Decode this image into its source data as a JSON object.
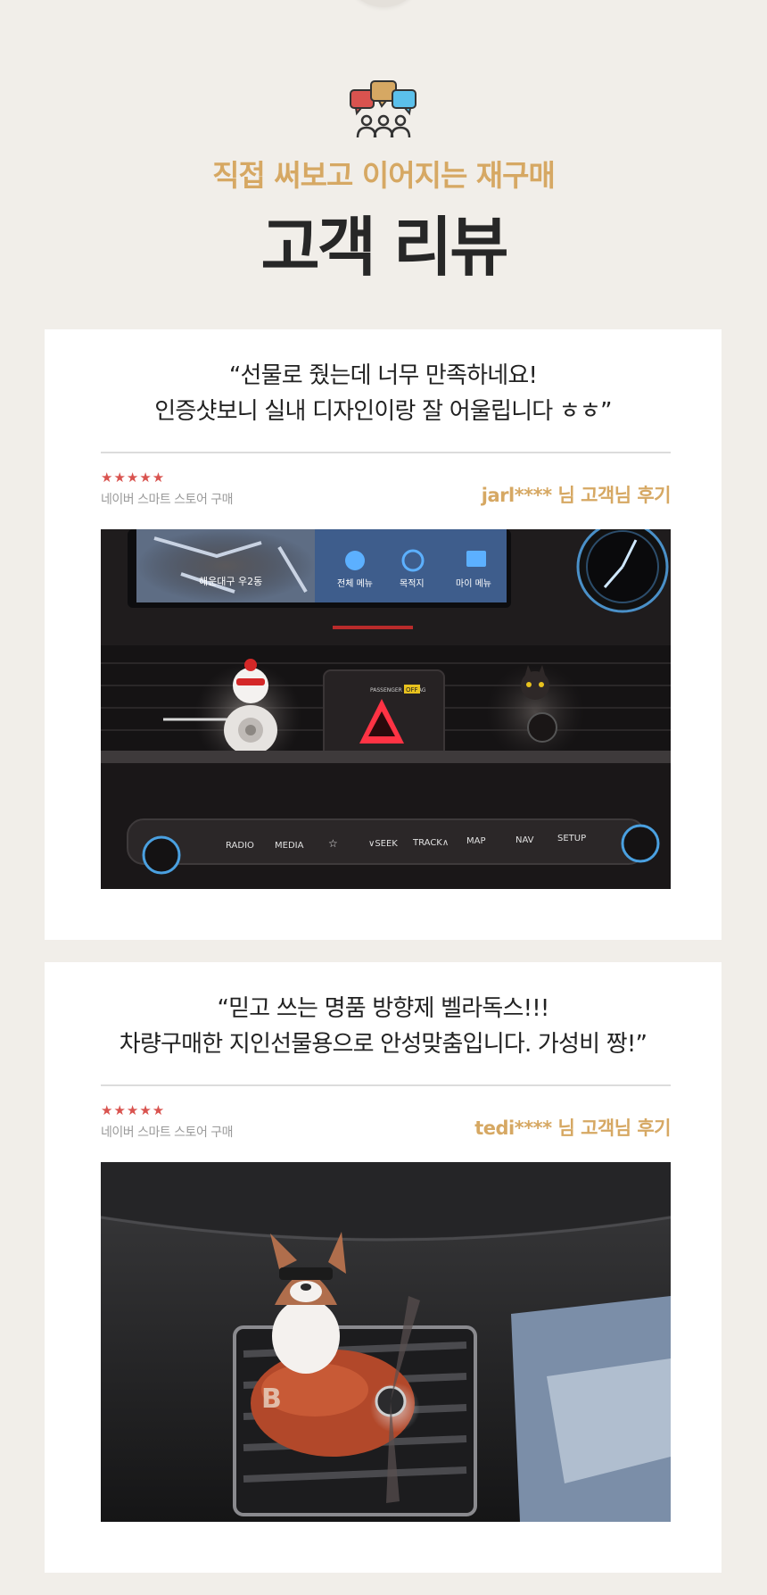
{
  "header": {
    "subtitle": "직접 써보고 이어지는 재구매",
    "title": "고객 리뷰",
    "icon": "customer-chat-icon"
  },
  "colors": {
    "background": "#f1eee9",
    "accent": "#d6a863",
    "stars": "#d9534f",
    "card": "#ffffff"
  },
  "reviews": [
    {
      "quote_line1": "“선물로 줬는데 너무 만족하네요!",
      "quote_line2": "인증샷보니 실내 디자인이랑 잘 어울립니다 ㅎㅎ”",
      "stars": "★★★★★",
      "source": "네이버 스마트 스토어 구매",
      "reviewer": "jarl**** 님 고객님 후기",
      "photo": {
        "screen_labels": [
          "해운대구 우2동",
          "전체 메뉴",
          "목적지",
          "마이 메뉴"
        ],
        "hazard_label": "PASSENGER AIR BAG",
        "hazard_badge": "OFF",
        "buttons": [
          "RADIO",
          "MEDIA",
          "☆",
          "∨SEEK",
          "TRACK∧",
          "MAP",
          "NAV",
          "SETUP"
        ]
      }
    },
    {
      "quote_line1": "“믿고 쓰는 명품 방향제 벨라독스!!!",
      "quote_line2": "차량구매한 지인선물용으로 안성맞춤입니다. 가성비 짱!”",
      "stars": "★★★★★",
      "source": "네이버 스마트 스토어 구매",
      "reviewer": "tedi**** 님 고객님 후기"
    }
  ]
}
